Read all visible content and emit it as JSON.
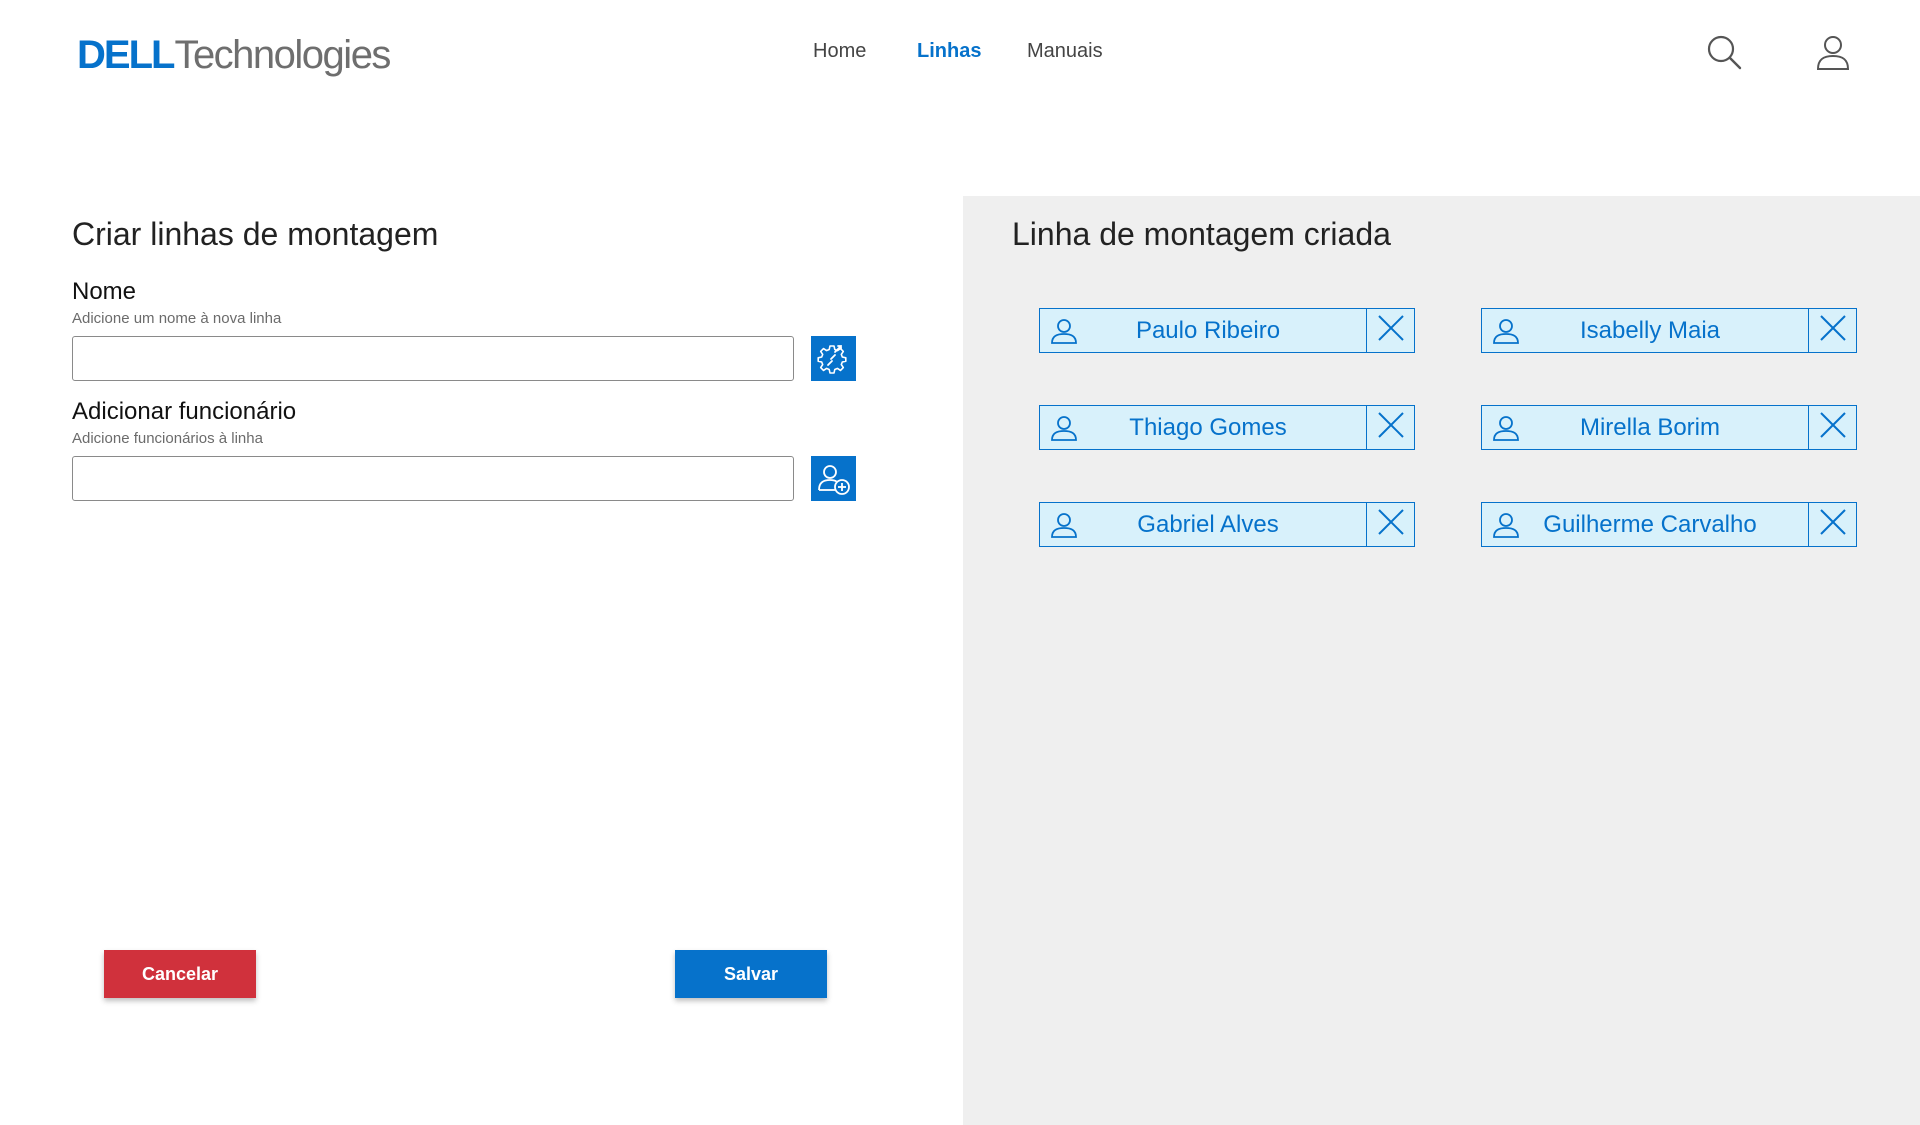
{
  "brand": {
    "dell": "DELL",
    "technologies": "Technologies"
  },
  "nav": [
    {
      "label": "Home",
      "active": false
    },
    {
      "label": "Linhas",
      "active": true
    },
    {
      "label": "Manuais",
      "active": false
    }
  ],
  "header_icons": [
    "search-icon",
    "user-icon"
  ],
  "form": {
    "title": "Criar linhas de montagem",
    "name_label": "Nome",
    "name_hint": "Adicione um nome à nova linha",
    "name_value": "",
    "name_button_icon": "gear-wrench-icon",
    "employee_label": "Adicionar funcionário",
    "employee_hint": "Adicione funcionários à linha",
    "employee_value": "",
    "employee_button_icon": "user-add-icon"
  },
  "actions": {
    "cancel_label": "Cancelar",
    "save_label": "Salvar"
  },
  "created": {
    "title": "Linha de montagem criada",
    "employees": [
      "Paulo Ribeiro",
      "Isabelly Maia",
      "Thiago Gomes",
      "Mirella Borim",
      "Gabriel Alves",
      "Guilherme Carvalho"
    ]
  },
  "colors": {
    "accent": "#0672cb",
    "danger": "#d0313c",
    "chip_bg": "#d8f1fb",
    "panel_bg": "#efefef"
  }
}
